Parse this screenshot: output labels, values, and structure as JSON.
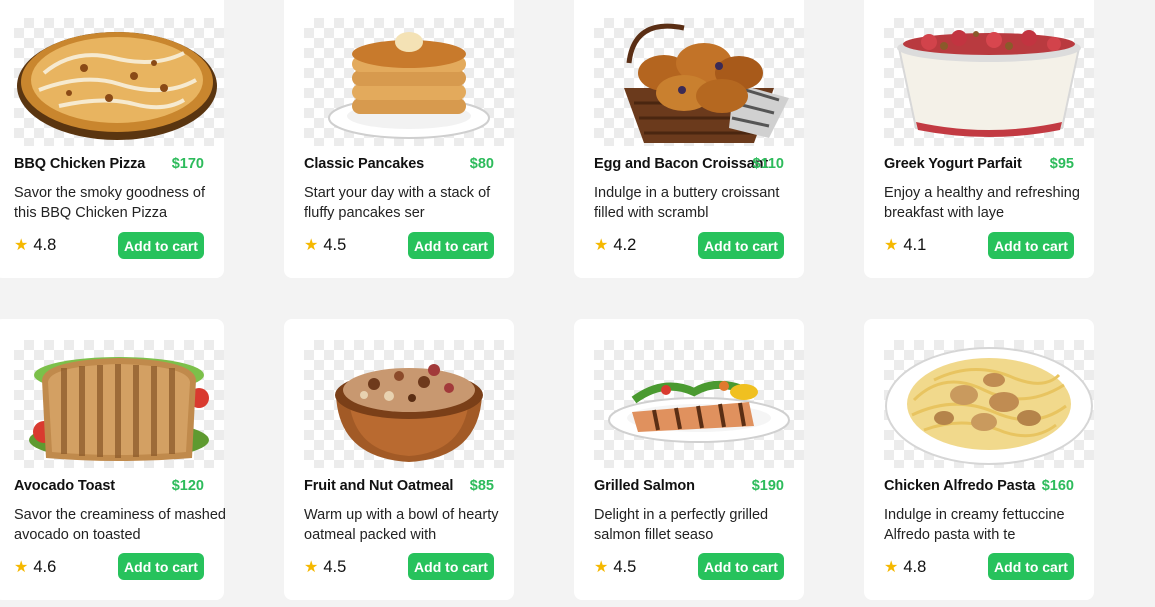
{
  "products": [
    {
      "name": "BBQ Chicken Pizza",
      "price": "$170",
      "description": "Savor the smoky goodness of this BBQ Chicken Pizza",
      "rating": "4.8",
      "button": "Add to cart",
      "image": "pizza"
    },
    {
      "name": "Classic Pancakes",
      "price": "$80",
      "description": "Start your day with a stack of fluffy pancakes ser",
      "rating": "4.5",
      "button": "Add to cart",
      "image": "pancakes"
    },
    {
      "name": "Egg and Bacon Croissant",
      "price": "$110",
      "description": "Indulge in a buttery croissant filled with scrambl",
      "rating": "4.2",
      "button": "Add to cart",
      "image": "croissant-basket"
    },
    {
      "name": "Greek Yogurt Parfait",
      "price": "$95",
      "description": "Enjoy a healthy and refreshing breakfast with laye",
      "rating": "4.1",
      "button": "Add to cart",
      "image": "yogurt-parfait"
    },
    {
      "name": "Avocado Toast",
      "price": "$120",
      "description": "Savor the creaminess of mashed avocado on toasted",
      "rating": "4.6",
      "button": "Add to cart",
      "image": "avocado-toast"
    },
    {
      "name": "Fruit and Nut Oatmeal",
      "price": "$85",
      "description": "Warm up with a bowl of hearty oatmeal packed with",
      "rating": "4.5",
      "button": "Add to cart",
      "image": "oatmeal-bowl"
    },
    {
      "name": "Grilled Salmon",
      "price": "$190",
      "description": "Delight in a perfectly grilled salmon fillet seaso",
      "rating": "4.5",
      "button": "Add to cart",
      "image": "grilled-salmon"
    },
    {
      "name": "Chicken Alfredo Pasta",
      "price": "$160",
      "description": "Indulge in creamy fettuccine Alfredo pasta with te",
      "rating": "4.8",
      "button": "Add to cart",
      "image": "alfredo-pasta"
    }
  ],
  "colors": {
    "accent": "#27c25c",
    "price": "#2dbb5b",
    "star": "#f5b800",
    "background": "#f3f3f3"
  },
  "icons": {
    "rating": "star-icon"
  }
}
